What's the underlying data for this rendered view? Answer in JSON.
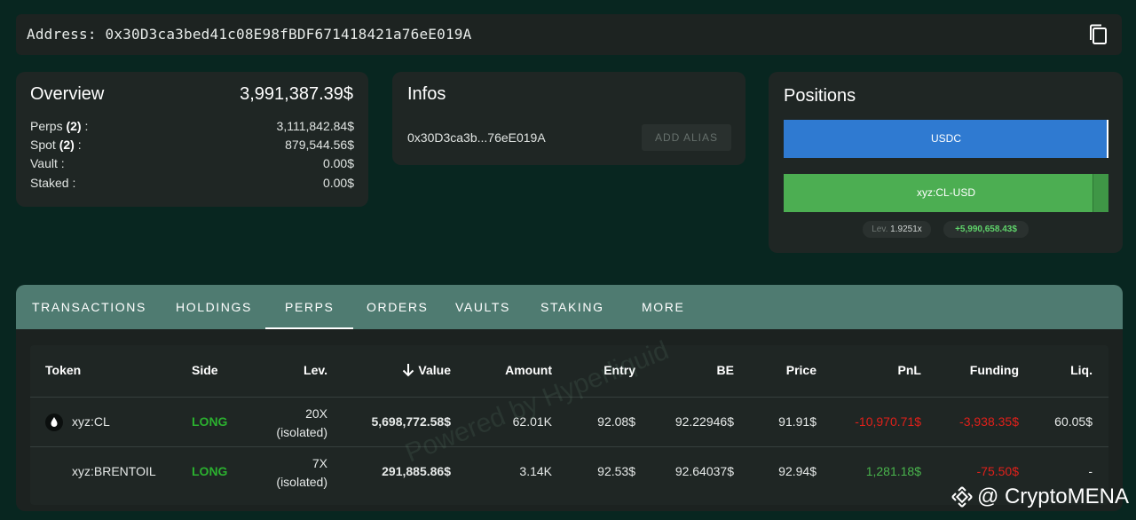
{
  "address_bar": {
    "label": "Address: 0x30D3ca3bed41c08E98fBDF671418421a76eE019A",
    "copy_icon": "copy-icon"
  },
  "overview": {
    "title": "Overview",
    "total": "3,991,387.39$",
    "rows": [
      {
        "label": "Perps",
        "count": "(2)",
        "suffix": " :",
        "value": "3,111,842.84$"
      },
      {
        "label": "Spot",
        "count": "(2)",
        "suffix": " :",
        "value": "879,544.56$"
      },
      {
        "label": "Vault :",
        "count": "",
        "suffix": "",
        "value": "0.00$"
      },
      {
        "label": "Staked :",
        "count": "",
        "suffix": "",
        "value": "0.00$"
      }
    ]
  },
  "infos": {
    "title": "Infos",
    "short_address": "0x30D3ca3b...76eE019A",
    "add_alias": "ADD ALIAS"
  },
  "positions": {
    "title": "Positions",
    "usdc_label": "USDC",
    "cl_label": "xyz:CL-USD",
    "lev_prefix": "Lev.",
    "lev_value": "1.9251x",
    "pnl": "+5,990,658.43$",
    "colors": {
      "usdc": "#2f7ad1",
      "cl": "#4cae52"
    }
  },
  "tabs": [
    "TRANSACTIONS",
    "HOLDINGS",
    "PERPS",
    "ORDERS",
    "VAULTS",
    "STAKING",
    "MORE"
  ],
  "active_tab": "PERPS",
  "table": {
    "headers": [
      "Token",
      "Side",
      "Lev.",
      "Value",
      "Amount",
      "Entry",
      "BE",
      "Price",
      "PnL",
      "Funding",
      "Liq."
    ],
    "sort_icon": "arrow-down-icon",
    "rows": [
      {
        "token": "xyz:CL",
        "side": "LONG",
        "lev": "20X",
        "mode": "(isolated)",
        "value": "5,698,772.58$",
        "amount": "62.01K",
        "entry": "92.08$",
        "be": "92.22946$",
        "price": "91.91$",
        "pnl": "-10,970.71$",
        "funding": "-3,938.35$",
        "liq": "60.05$"
      },
      {
        "token": "xyz:BRENTOIL",
        "side": "LONG",
        "lev": "7X",
        "mode": "(isolated)",
        "value": "291,885.86$",
        "amount": "3.14K",
        "entry": "92.53$",
        "be": "92.64037$",
        "price": "92.94$",
        "pnl": "1,281.18$",
        "funding": "-75.50$",
        "liq": "-"
      }
    ]
  },
  "watermark": "Powered by Hyperliquid",
  "credit": "@ CryptoMENA"
}
